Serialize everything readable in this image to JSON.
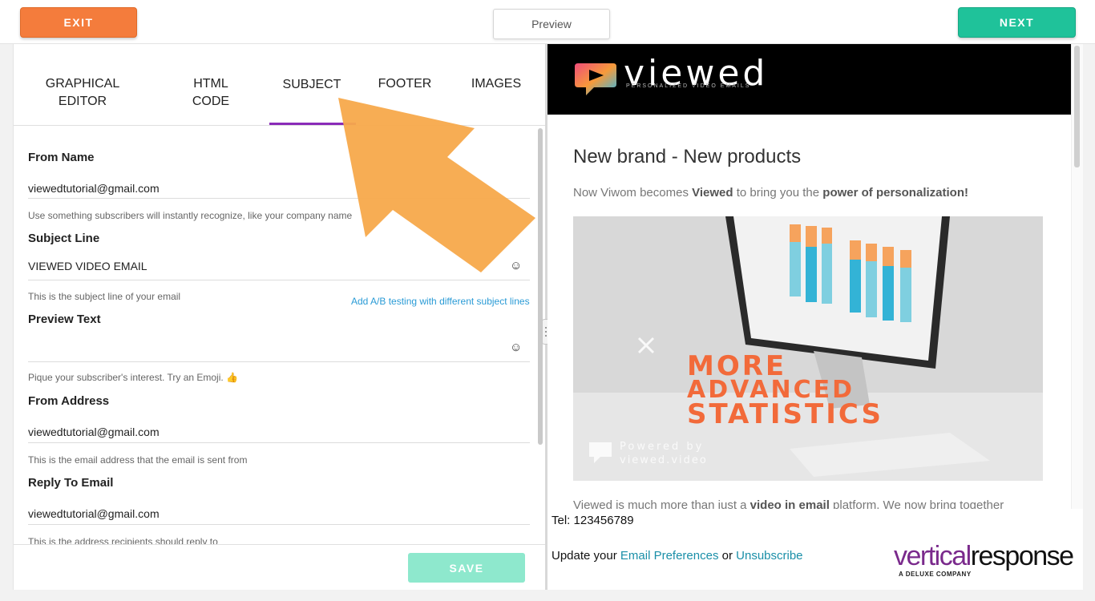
{
  "topbar": {
    "exit_label": "EXIT",
    "preview_label": "Preview",
    "next_label": "NEXT"
  },
  "tabs": {
    "graphical_editor": "GRAPHICAL EDITOR",
    "html_code": "HTML CODE",
    "subject": "SUBJECT",
    "footer": "FOOTER",
    "images": "IMAGES",
    "active": "SUBJECT"
  },
  "form": {
    "from_name": {
      "label": "From Name",
      "value": "viewedtutorial@gmail.com",
      "help": "Use something subscribers will instantly recognize, like your company name"
    },
    "subject_line": {
      "label": "Subject Line",
      "value": "VIEWED VIDEO EMAIL",
      "help": "This is the subject line of your email",
      "ab_link": "Add A/B testing with different subject lines"
    },
    "preview_text": {
      "label": "Preview Text",
      "value": "",
      "help": "Pique your subscriber's interest. Try an Emoji. 👍"
    },
    "from_address": {
      "label": "From Address",
      "value": "viewedtutorial@gmail.com",
      "help": "This is the email address that the email is sent from"
    },
    "reply_to": {
      "label": "Reply To Email",
      "value": "viewedtutorial@gmail.com",
      "help": "This is the address recipients should reply to"
    },
    "emoji_icon": "☺",
    "save_label": "SAVE"
  },
  "preview": {
    "logo_text": "viewed",
    "logo_tagline": "PERSONALIZED VIDEO EMAILS",
    "title": "New brand - New products",
    "intro_prefix": "Now Viwom becomes ",
    "intro_bold1": "Viewed",
    "intro_mid": " to bring you the ",
    "intro_bold2": "power of personalization!",
    "hero_line1": "MORE",
    "hero_line2": "ADVANCED",
    "hero_line3": "STATISTICS",
    "hero_powered": "Powered by",
    "hero_site": "viewed.video",
    "body_prefix": "Viewed is much more than just a ",
    "body_bold": "video in email",
    "body_suffix": " platform. We now bring together"
  },
  "footer": {
    "tel": "Tel: 123456789",
    "prefs_prefix": "Update your ",
    "prefs_link": "Email Preferences",
    "prefs_or": " or ",
    "unsubscribe_link": "Unsubscribe",
    "brand_v": "vertical",
    "brand_r": "response",
    "brand_sub": "A DELUXE COMPANY"
  },
  "colors": {
    "exit": "#f47c3c",
    "next": "#1fc29a",
    "save": "#8ee8cd",
    "tab_active": "#8a2bb8",
    "link": "#2a9bd6",
    "arrow": "#f7a94b",
    "hero_text": "#f26a3a"
  }
}
